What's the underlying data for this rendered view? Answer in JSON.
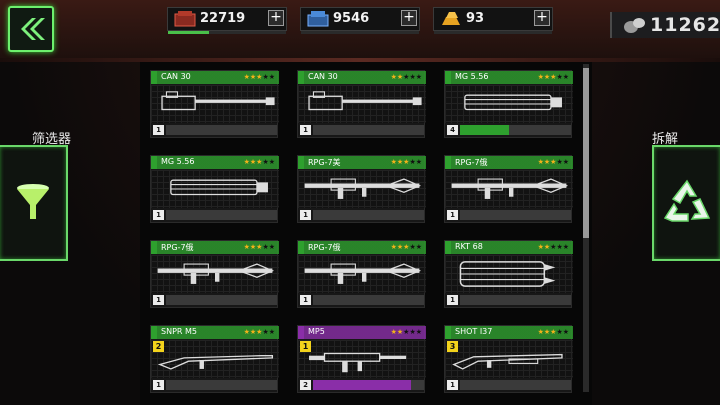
{
  "header": {
    "resources": [
      {
        "name": "red-crate",
        "value": "22719",
        "progress": 0.35,
        "color": "#b23a2a"
      },
      {
        "name": "blue-crate",
        "value": "9546",
        "progress": 0.0,
        "color": "#4a8ad8"
      },
      {
        "name": "gold-bars",
        "value": "93",
        "progress": 0.0,
        "color": "#e7a321"
      }
    ],
    "coins": "11262",
    "plus_label": "+"
  },
  "left_panel": {
    "label": "筛选器"
  },
  "right_panel": {
    "label": "拆解"
  },
  "colors": {
    "accent_green": "#2ea02e",
    "accent_purple": "#8a2ea8",
    "star": "#f2b21a"
  },
  "weapons": [
    {
      "name": "CAN 30",
      "stars": 3,
      "level": "1",
      "progress": 0.0,
      "rarity": "green",
      "icon": "cannon-icon"
    },
    {
      "name": "CAN 30",
      "stars": 2,
      "level": "1",
      "progress": 0.0,
      "rarity": "green",
      "icon": "cannon-icon"
    },
    {
      "name": "MG 5.56",
      "stars": 3,
      "level": "4",
      "progress": 0.44,
      "rarity": "green",
      "icon": "minigun-icon"
    },
    {
      "name": "MG 5.56",
      "stars": 3,
      "level": "1",
      "progress": 0.0,
      "rarity": "green",
      "icon": "minigun-icon"
    },
    {
      "name": "RPG-7美",
      "stars": 3,
      "level": "1",
      "progress": 0.0,
      "rarity": "green",
      "icon": "rpg-icon"
    },
    {
      "name": "RPG-7俄",
      "stars": 3,
      "level": "1",
      "progress": 0.0,
      "rarity": "green",
      "icon": "rpg-icon"
    },
    {
      "name": "RPG-7俄",
      "stars": 3,
      "level": "1",
      "progress": 0.0,
      "rarity": "green",
      "icon": "rpg-icon"
    },
    {
      "name": "RPG-7俄",
      "stars": 3,
      "level": "1",
      "progress": 0.0,
      "rarity": "green",
      "icon": "rpg-icon"
    },
    {
      "name": "RKT 68",
      "stars": 2,
      "level": "1",
      "progress": 0.0,
      "rarity": "green",
      "icon": "rocket-pod-icon"
    },
    {
      "name": "SNPR M5",
      "stars": 3,
      "level": "1",
      "progress": 0.0,
      "rarity": "green",
      "tier": "2",
      "icon": "sniper-icon"
    },
    {
      "name": "MP5",
      "stars": 2,
      "level": "2",
      "progress": 0.88,
      "rarity": "purple",
      "tier": "1",
      "icon": "smg-icon"
    },
    {
      "name": "SHOT I37",
      "stars": 3,
      "level": "1",
      "progress": 0.0,
      "rarity": "green",
      "tier": "3",
      "icon": "shotgun-icon"
    }
  ]
}
